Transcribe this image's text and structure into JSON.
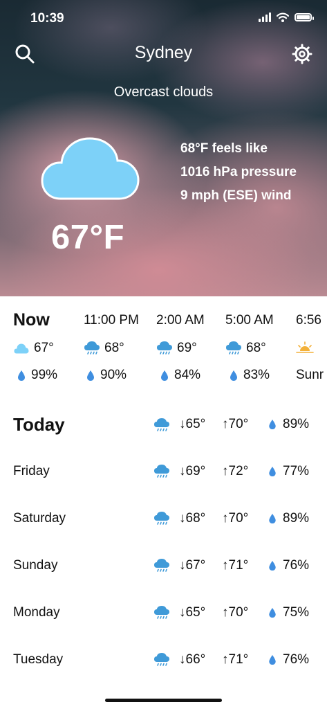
{
  "status_bar": {
    "time": "10:39"
  },
  "header": {
    "city": "Sydney",
    "condition": "Overcast clouds",
    "search_icon": "search-icon",
    "settings_icon": "gear-icon"
  },
  "current": {
    "temperature": "67°F",
    "icon": "cloud-icon",
    "feels_like": "68°F feels like",
    "pressure": "1016 hPa pressure",
    "wind": "9 mph (ESE) wind"
  },
  "hourly": [
    {
      "time": "Now",
      "icon": "cloud-icon",
      "temp": "67°",
      "precip": "99%"
    },
    {
      "time": "11:00 PM",
      "icon": "rain-cloud-icon",
      "temp": "68°",
      "precip": "90%"
    },
    {
      "time": "2:00 AM",
      "icon": "rain-cloud-icon",
      "temp": "69°",
      "precip": "84%"
    },
    {
      "time": "5:00 AM",
      "icon": "rain-cloud-icon",
      "temp": "68°",
      "precip": "83%"
    },
    {
      "time": "6:56",
      "icon": "sunrise-icon",
      "temp": "",
      "precip": "Sunr"
    }
  ],
  "daily": [
    {
      "day": "Today",
      "icon": "rain-cloud-icon",
      "low": "↓65°",
      "high": "↑70°",
      "precip": "89%"
    },
    {
      "day": "Friday",
      "icon": "rain-cloud-icon",
      "low": "↓69°",
      "high": "↑72°",
      "precip": "77%"
    },
    {
      "day": "Saturday",
      "icon": "rain-cloud-icon",
      "low": "↓68°",
      "high": "↑70°",
      "precip": "89%"
    },
    {
      "day": "Sunday",
      "icon": "rain-cloud-icon",
      "low": "↓67°",
      "high": "↑71°",
      "precip": "76%"
    },
    {
      "day": "Monday",
      "icon": "rain-cloud-icon",
      "low": "↓65°",
      "high": "↑70°",
      "precip": "75%"
    },
    {
      "day": "Tuesday",
      "icon": "rain-cloud-icon",
      "low": "↓66°",
      "high": "↑71°",
      "precip": "76%"
    }
  ],
  "colors": {
    "cloud": "#7dd1f8",
    "rain_icon": "#3f9ad8",
    "drop": "#3f8ee0",
    "sun": "#f3b13a"
  }
}
